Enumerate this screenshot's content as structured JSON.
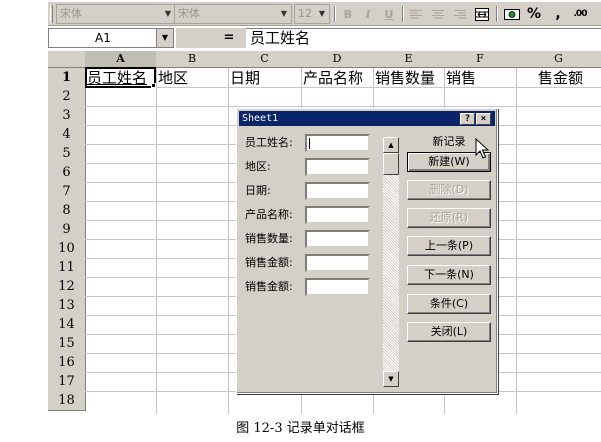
{
  "toolbar": {
    "font_name": "宋体",
    "font_name_2": "宋体",
    "font_size": "12",
    "bold": "B",
    "italic": "I",
    "underline": "U",
    "percent": "%",
    "comma": ",",
    "decimal": ".00"
  },
  "formula_bar": {
    "cell_ref": "A1",
    "equals": "=",
    "content": "员工姓名"
  },
  "grid": {
    "columns": [
      "A",
      "B",
      "C",
      "D",
      "E",
      "F",
      "G"
    ],
    "rows": [
      "1",
      "2",
      "3",
      "4",
      "5",
      "6",
      "7",
      "8",
      "9",
      "10",
      "11",
      "12",
      "13",
      "14",
      "15",
      "16",
      "17",
      "18"
    ],
    "row1": [
      "员工姓名",
      "地区",
      "日期",
      "产品名称",
      "销售数量",
      "销售",
      "售金额"
    ]
  },
  "dialog": {
    "title": "Sheet1",
    "help": "?",
    "close": "×",
    "new_record": "新记录",
    "fields": [
      "员工姓名:",
      "地区:",
      "日期:",
      "产品名称:",
      "销售数量:",
      "销售金额:",
      "销售金额:"
    ],
    "buttons": {
      "new": "新建(W)",
      "delete": "删除(D)",
      "restore": "还原(R)",
      "prev": "上一条(P)",
      "next": "下一条(N)",
      "criteria": "条件(C)",
      "close": "关闭(L)"
    }
  },
  "caption": "图 12-3 记录单对话框"
}
